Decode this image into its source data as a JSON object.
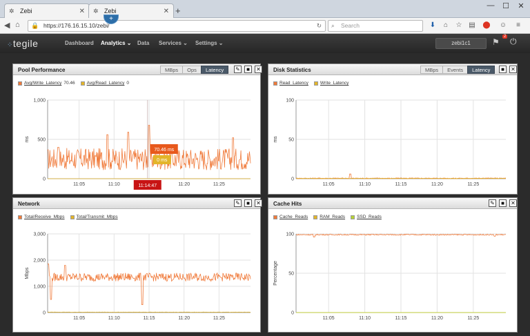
{
  "browser": {
    "tabs": [
      {
        "title": "Zebi",
        "close": "✕"
      },
      {
        "title": "Zebi",
        "close": "✕"
      }
    ],
    "new_tab": "+",
    "window_controls": [
      "—",
      "☐",
      "✕"
    ],
    "url": "https://176.16.15.10/zebi/",
    "search_placeholder": "Search"
  },
  "app": {
    "logo": "tegile",
    "nav": [
      {
        "label": "Dashboard"
      },
      {
        "label": "Analytics ⌄"
      },
      {
        "label": "Data"
      },
      {
        "label": "Services ⌄"
      },
      {
        "label": "Settings ⌄"
      }
    ],
    "add_button": "+",
    "user": "zebi1c1",
    "notification_count": "2"
  },
  "panels": {
    "pool": {
      "title": "Pool Performance",
      "segments": [
        "MBps",
        "Ops",
        "Latency"
      ],
      "active_segment": "Latency",
      "legend": [
        {
          "label": "Avg/Write_Latency",
          "value": "70.46",
          "color": "#f07a3a"
        },
        {
          "label": "Avg/Read_Latency",
          "value": "0",
          "color": "#e3b52a"
        }
      ],
      "ylabel": "ms",
      "tooltip_write": "70.46 ms",
      "tooltip_read": "0 ms",
      "tooltip_time": "11:14:47"
    },
    "disk": {
      "title": "Disk Statistics",
      "segments": [
        "MBps",
        "Events",
        "Latency"
      ],
      "active_segment": "Latency",
      "legend": [
        {
          "label": "Read_Latency",
          "color": "#f07a3a"
        },
        {
          "label": "Write_Latency",
          "color": "#e3b52a"
        }
      ],
      "ylabel": "ms"
    },
    "network": {
      "title": "Network",
      "legend": [
        {
          "label": "Total/Receive_Mbps",
          "color": "#f07a3a"
        },
        {
          "label": "Total/Transmit_Mbps",
          "color": "#e3b52a"
        }
      ],
      "ylabel": "Mbps"
    },
    "cache": {
      "title": "Cache Hits",
      "legend": [
        {
          "label": "Cache_Reads",
          "color": "#f07a3a"
        },
        {
          "label": "RAM_Reads",
          "color": "#e3b52a"
        },
        {
          "label": "SSD_Reads",
          "color": "#b7d234"
        }
      ],
      "ylabel": "Percentage"
    }
  },
  "chart_data": [
    {
      "type": "line",
      "title": "Pool Performance",
      "ylabel": "ms",
      "ylim": [
        0,
        1000
      ],
      "yticks": [
        "0",
        "500",
        "1,000"
      ],
      "xticks": [
        "11:05",
        "11:10",
        "11:15",
        "11:20",
        "11:25"
      ],
      "x_minutes": [
        5,
        10,
        15,
        20,
        25
      ],
      "xlim_minutes": [
        0.5,
        29.5
      ],
      "series": [
        {
          "name": "Avg/Write_Latency",
          "color": "#f07a3a",
          "baseline": 250,
          "noise": 140,
          "spikes": [
            [
              2,
              400
            ],
            [
              9,
              560
            ],
            [
              12,
              590
            ],
            [
              15,
              680
            ],
            [
              27,
              520
            ]
          ]
        },
        {
          "name": "Avg/Read_Latency",
          "color": "#e3b52a",
          "baseline": 0,
          "noise": 0,
          "spikes": []
        }
      ],
      "cursor_minute": 14.78
    },
    {
      "type": "line",
      "title": "Disk Statistics",
      "ylabel": "ms",
      "ylim": [
        0,
        100
      ],
      "yticks": [
        "0",
        "50",
        "100"
      ],
      "xticks": [
        "11:05",
        "11:10",
        "11:15",
        "11:20",
        "11:25"
      ],
      "x_minutes": [
        5,
        10,
        15,
        20,
        25
      ],
      "xlim_minutes": [
        0.5,
        29.5
      ],
      "series": [
        {
          "name": "Read_Latency",
          "color": "#f07a3a",
          "baseline": 0.5,
          "noise": 0.6,
          "spikes": [
            [
              8,
              6
            ]
          ]
        },
        {
          "name": "Write_Latency",
          "color": "#e3b52a",
          "baseline": 0.3,
          "noise": 0.3,
          "spikes": []
        }
      ]
    },
    {
      "type": "line",
      "title": "Network",
      "ylabel": "Mbps",
      "ylim": [
        0,
        3000
      ],
      "yticks": [
        "0",
        "1,000",
        "2,000",
        "3,000"
      ],
      "xticks": [
        "11:05",
        "11:10",
        "11:15",
        "11:20",
        "11:25"
      ],
      "x_minutes": [
        5,
        10,
        15,
        20,
        25
      ],
      "xlim_minutes": [
        0.5,
        29.5
      ],
      "series": [
        {
          "name": "Total/Receive_Mbps",
          "color": "#f07a3a",
          "baseline": 1350,
          "noise": 160,
          "spikes": [
            [
              0.6,
              1850
            ],
            [
              1.0,
              500
            ],
            [
              3,
              1800
            ],
            [
              14,
              300
            ]
          ]
        },
        {
          "name": "Total/Transmit_Mbps",
          "color": "#e3b52a",
          "baseline": 15,
          "noise": 5,
          "spikes": []
        }
      ]
    },
    {
      "type": "line",
      "title": "Cache Hits",
      "ylabel": "Percentage",
      "ylim": [
        0,
        100
      ],
      "yticks": [
        "0",
        "50",
        "100"
      ],
      "xticks": [
        "11:05",
        "11:10",
        "11:15",
        "11:20",
        "11:25"
      ],
      "x_minutes": [
        5,
        10,
        15,
        20,
        25
      ],
      "xlim_minutes": [
        0.5,
        29.5
      ],
      "series": [
        {
          "name": "Cache_Reads",
          "color": "#f07a3a",
          "baseline": 99,
          "noise": 0.7,
          "spikes": [
            [
              3,
              96
            ],
            [
              28,
              97
            ]
          ]
        },
        {
          "name": "RAM_Reads",
          "color": "#e3b52a",
          "baseline": 0,
          "noise": 0,
          "spikes": []
        },
        {
          "name": "SSD_Reads",
          "color": "#b7d234",
          "baseline": 0,
          "noise": 0,
          "spikes": []
        }
      ]
    }
  ]
}
